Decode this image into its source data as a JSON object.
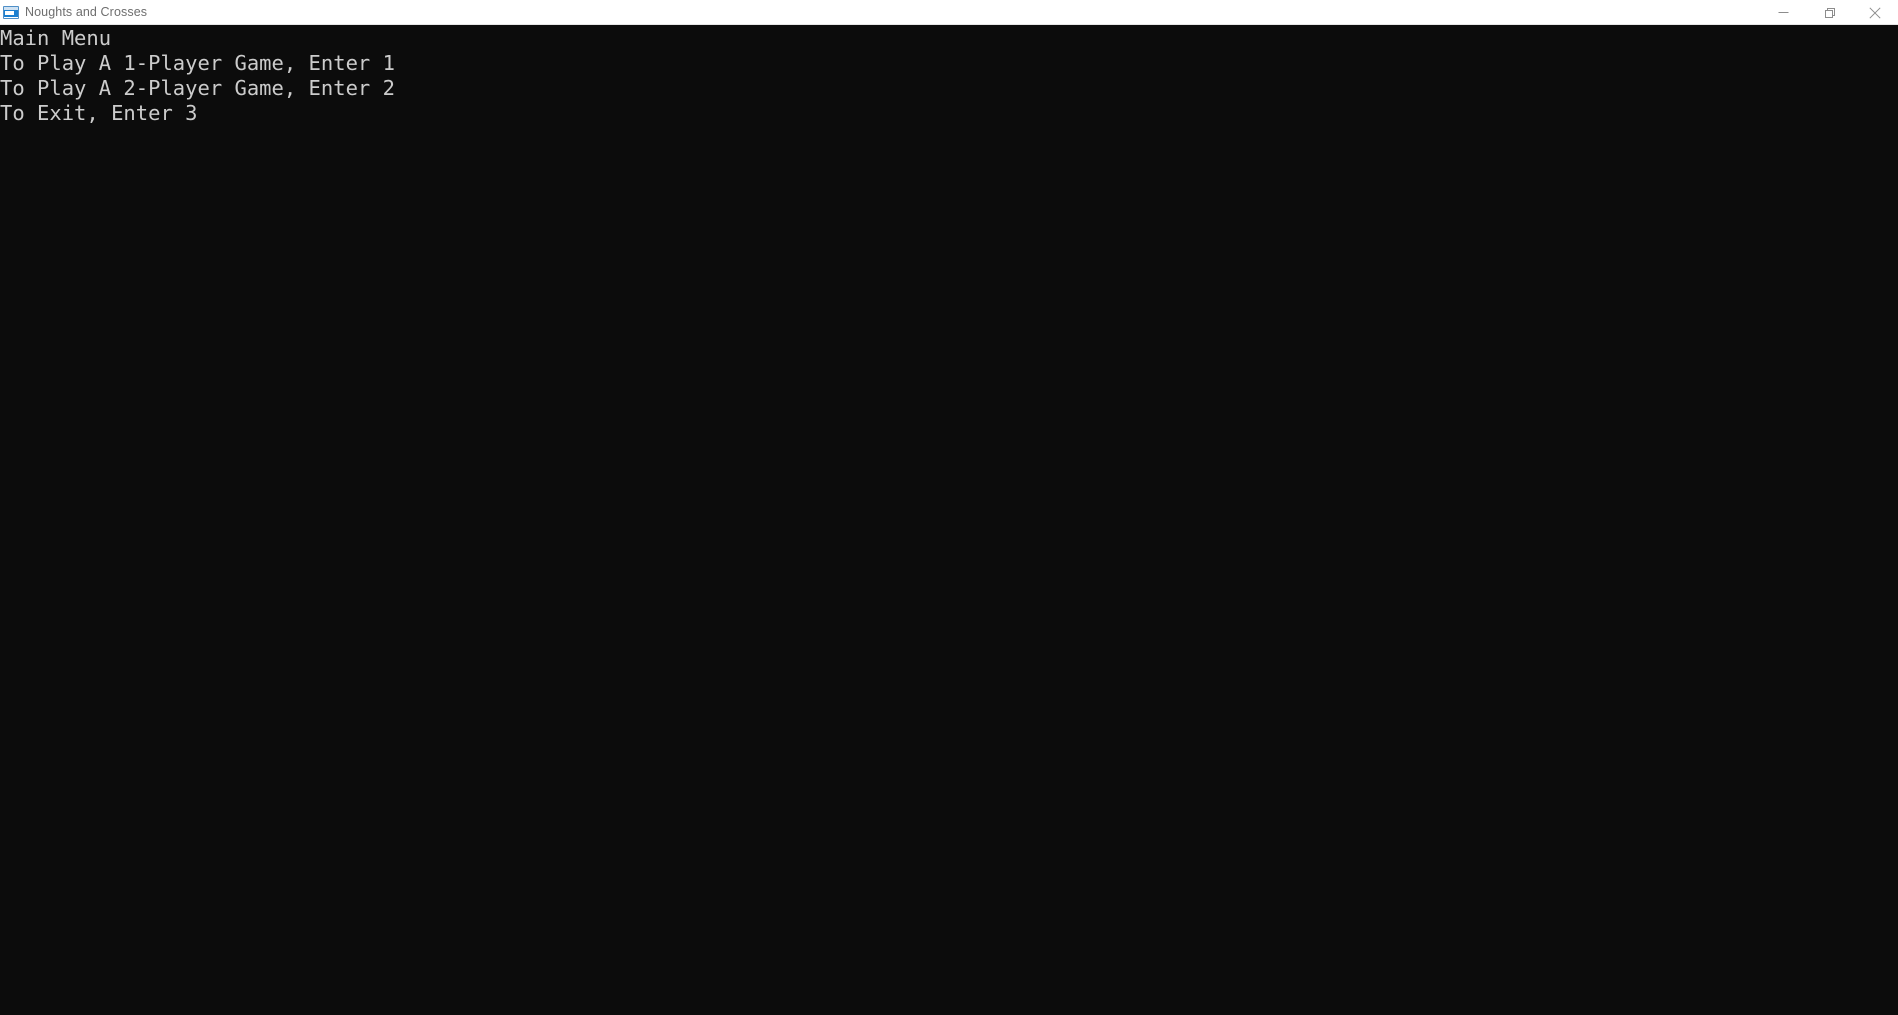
{
  "window": {
    "title": "Noughts and Crosses",
    "app_icon": "console-window-icon",
    "titlebar_bg": "#ffffff",
    "title_color": "#6e6e6e",
    "console_bg": "#0c0c0c",
    "console_fg": "#cccccc"
  },
  "window_controls": {
    "minimize": {
      "name": "minimize-button",
      "glyph": "minimize-icon",
      "label": "Minimize"
    },
    "restore": {
      "name": "restore-button",
      "glyph": "restore-icon",
      "label": "Restore Down"
    },
    "close": {
      "name": "close-button",
      "glyph": "close-icon",
      "label": "Close"
    }
  },
  "console": {
    "lines": [
      "Main Menu",
      "To Play A 1-Player Game, Enter 1",
      "To Play A 2-Player Game, Enter 2",
      "To Exit, Enter 3"
    ],
    "menu": {
      "heading": "Main Menu",
      "options": [
        {
          "key": "1",
          "text": "To Play A 1-Player Game, Enter 1"
        },
        {
          "key": "2",
          "text": "To Play A 2-Player Game, Enter 2"
        },
        {
          "key": "3",
          "text": "To Exit, Enter 3"
        }
      ]
    }
  }
}
